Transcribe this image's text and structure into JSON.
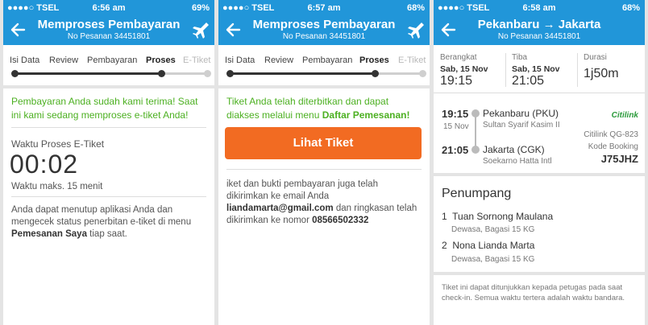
{
  "screens": [
    {
      "status": {
        "carrier": "●●●●○ TSEL",
        "time": "6:56 am",
        "battery": "69%"
      },
      "header": {
        "title": "Memproses Pembayaran",
        "subtitle": "No Pesanan 34451801"
      },
      "steps": [
        "Isi Data",
        "Review",
        "Pembayaran",
        "Proses",
        "E-Tiket"
      ],
      "active_step": "Proses",
      "message": {
        "text": "Pembayaran Anda sudah kami terima! Saat ini kami sedang memproses e-tiket Anda!"
      },
      "timer": {
        "label": "Waktu Proses E-Tiket",
        "value": "00:02",
        "note": "Waktu maks. 15 menit"
      },
      "info": {
        "text_a": "Anda dapat menutup aplikasi Anda dan mengecek status penerbitan e-tiket di menu ",
        "highlight": "Pemesanan Saya",
        "text_b": " tiap saat."
      }
    },
    {
      "status": {
        "carrier": "●●●●○ TSEL",
        "time": "6:57 am",
        "battery": "68%"
      },
      "header": {
        "title": "Memproses Pembayaran",
        "subtitle": "No Pesanan 34451801"
      },
      "steps": [
        "Isi Data",
        "Review",
        "Pembayaran",
        "Proses",
        "E-Tiket"
      ],
      "active_step": "Proses",
      "message": {
        "text_a": "Tiket Anda telah diterbitkan dan dapat diakses melalui menu ",
        "highlight": "Daftar Pemesanan!"
      },
      "button": "Lihat Tiket",
      "info": {
        "text_a": "iket dan bukti pembayaran juga telah dikirimkan ke email Anda",
        "email": "liandamarta@gmail.com",
        "text_b": " dan ringkasan telah dikirimkan ke nomor ",
        "phone": "08566502332"
      }
    },
    {
      "status": {
        "carrier": "●●●●○ TSEL",
        "time": "6:58 am",
        "battery": "68%"
      },
      "header": {
        "from": "Pekanbaru",
        "arrow": "→",
        "to": "Jakarta",
        "subtitle": "No Pesanan 34451801"
      },
      "flight_summary": {
        "depart": {
          "label": "Berangkat",
          "date": "Sab, 15 Nov",
          "time": "19:15"
        },
        "arrive": {
          "label": "Tiba",
          "date": "Sab, 15 Nov",
          "time": "21:05"
        },
        "duration": {
          "label": "Durasi",
          "value": "1j50m"
        }
      },
      "itinerary": {
        "dep_time": "19:15",
        "dep_date": "15 Nov",
        "dep_city": "Pekanbaru (PKU)",
        "dep_airport": "Sultan Syarif Kasim II",
        "arr_time": "21:05",
        "arr_city": "Jakarta (CGK)",
        "arr_airport": "Soekarno Hatta Intl",
        "airline": "Citilink",
        "flight_no": "Citilink QG-823",
        "booking_label": "Kode Booking",
        "booking_code": "J75JHZ"
      },
      "passengers": {
        "title": "Penumpang",
        "list": [
          {
            "no": "1",
            "name": "Tuan Sornong Maulana",
            "detail": "Dewasa, Bagasi 15 KG"
          },
          {
            "no": "2",
            "name": "Nona Lianda Marta",
            "detail": "Dewasa, Bagasi 15 KG"
          }
        ]
      },
      "footnote": "Tiket ini dapat ditunjukkan kepada petugas pada saat check-in. Semua waktu tertera adalah waktu bandara."
    }
  ],
  "colors": {
    "brand": "#2196d9",
    "success": "#4cb021",
    "button": "#f26b22"
  }
}
